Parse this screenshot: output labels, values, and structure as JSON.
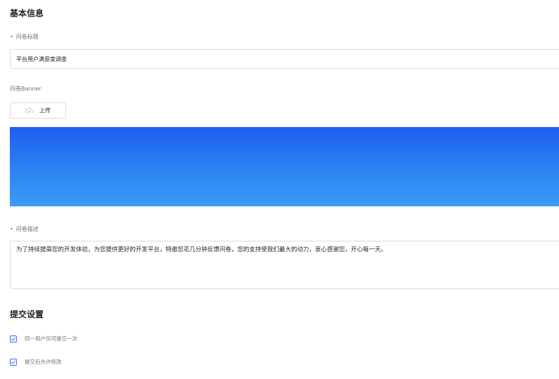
{
  "basic_info": {
    "title": "基本信息",
    "survey_title": {
      "label": "问卷标题",
      "required_mark": "•",
      "value": "平台用户满意度调查"
    },
    "banner": {
      "label": "问卷Banner",
      "upload_label": "上传",
      "upload_icon": "cloud-upload-icon",
      "gradient_colors": [
        "#1e5ff0",
        "#3b9bf5"
      ]
    },
    "description": {
      "label": "问卷描述",
      "required_mark": "•",
      "value": "为了持续提高您的开发体验，为您提供更好的开发平台，特邀您花几分钟反馈问卷，您的支持使我们最大的动力，衷心感谢您，开心每一天。"
    }
  },
  "submit_settings": {
    "title": "提交设置",
    "options": [
      {
        "label": "同一用户仅可提交一次",
        "checked": true
      },
      {
        "label": "提交后允许修改",
        "checked": true
      }
    ]
  },
  "colors": {
    "accent": "#3370ff",
    "required": "#f54a45",
    "border": "#d9dce2"
  }
}
